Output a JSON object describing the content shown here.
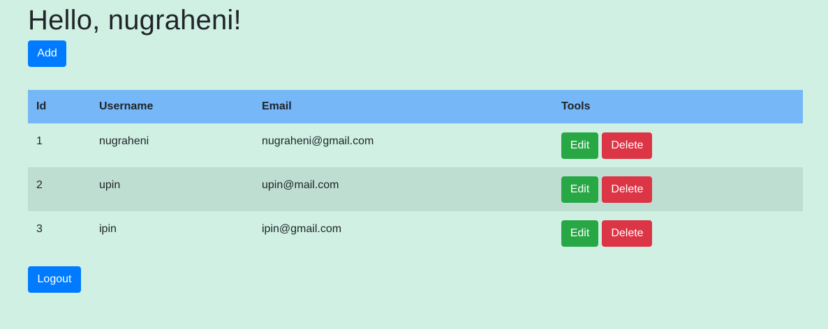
{
  "header": {
    "greeting": "Hello, nugraheni!"
  },
  "actions": {
    "add_label": "Add",
    "logout_label": "Logout"
  },
  "table": {
    "columns": [
      "Id",
      "Username",
      "Email",
      "Tools"
    ],
    "rows": [
      {
        "id": "1",
        "username": "nugraheni",
        "email": "nugraheni@gmail.com",
        "edit_label": "Edit",
        "delete_label": "Delete"
      },
      {
        "id": "2",
        "username": "upin",
        "email": "upin@mail.com",
        "edit_label": "Edit",
        "delete_label": "Delete"
      },
      {
        "id": "3",
        "username": "ipin",
        "email": "ipin@gmail.com",
        "edit_label": "Edit",
        "delete_label": "Delete"
      }
    ]
  },
  "colors": {
    "background": "#cff0e3",
    "header_row": "#76b7f7",
    "striped_row": "#bfded2",
    "primary": "#007bff",
    "success": "#28a745",
    "danger": "#dc3545"
  }
}
